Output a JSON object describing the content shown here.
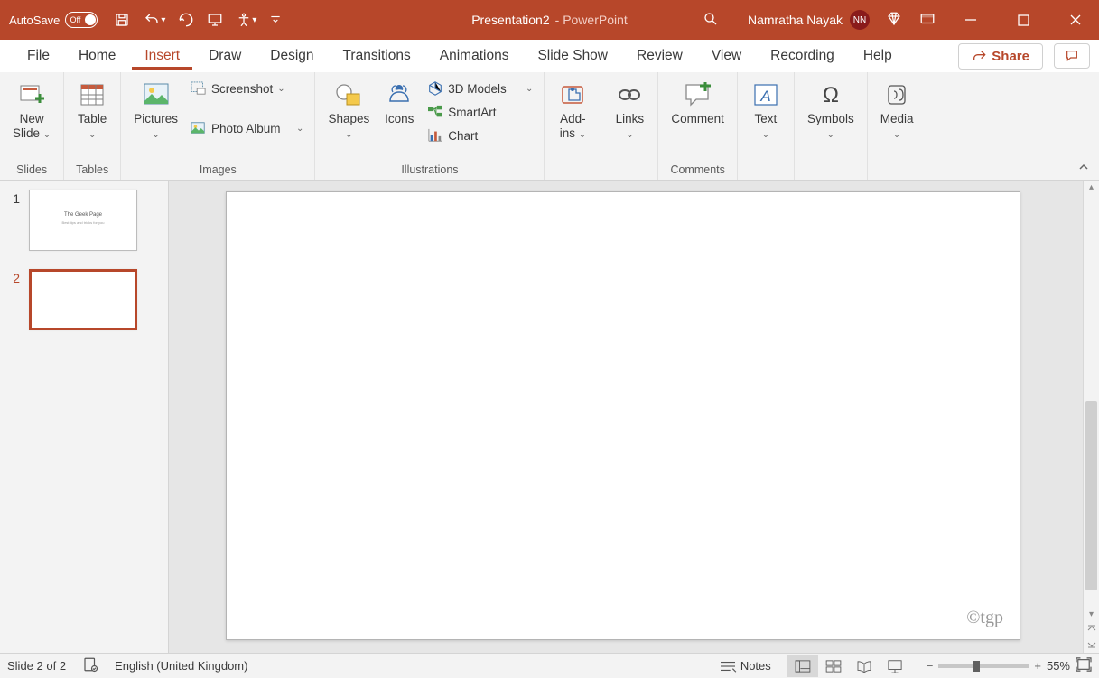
{
  "titlebar": {
    "autosave_label": "AutoSave",
    "autosave_state": "Off",
    "doc_name": "Presentation2",
    "app_name": "PowerPoint",
    "user_name": "Namratha Nayak",
    "user_initials": "NN"
  },
  "tabs": {
    "file": "File",
    "home": "Home",
    "insert": "Insert",
    "draw": "Draw",
    "design": "Design",
    "transitions": "Transitions",
    "animations": "Animations",
    "slideshow": "Slide Show",
    "review": "Review",
    "view": "View",
    "recording": "Recording",
    "help": "Help",
    "share": "Share"
  },
  "ribbon": {
    "slides": {
      "label": "Slides",
      "new_slide": "New\nSlide"
    },
    "tables": {
      "label": "Tables",
      "table": "Table"
    },
    "images": {
      "label": "Images",
      "pictures": "Pictures",
      "screenshot": "Screenshot",
      "photo_album": "Photo Album"
    },
    "illustrations": {
      "label": "Illustrations",
      "shapes": "Shapes",
      "icons": "Icons",
      "models": "3D Models",
      "smartart": "SmartArt",
      "chart": "Chart"
    },
    "addins": {
      "label": "",
      "addins": "Add-\nins"
    },
    "links": {
      "label": "",
      "links": "Links"
    },
    "comments": {
      "label": "Comments",
      "comment": "Comment"
    },
    "text": {
      "label": "",
      "text": "Text"
    },
    "symbols": {
      "label": "",
      "symbols": "Symbols"
    },
    "media": {
      "label": "",
      "media": "Media"
    }
  },
  "slides": {
    "items": [
      {
        "num": "1",
        "title": "The Geek Page",
        "sub": "Best tips and tricks for you"
      },
      {
        "num": "2",
        "title": "",
        "sub": ""
      }
    ]
  },
  "canvas": {
    "watermark": "©tgp"
  },
  "statusbar": {
    "slide_info": "Slide 2 of 2",
    "language": "English (United Kingdom)",
    "notes": "Notes",
    "zoom": "55%"
  }
}
